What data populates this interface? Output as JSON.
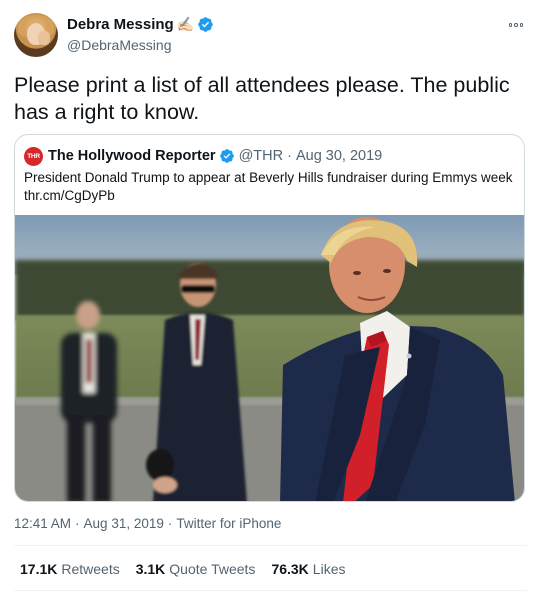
{
  "author": {
    "display_name": "Debra Messing",
    "name_emoji": "✍🏻",
    "handle": "@DebraMessing"
  },
  "tweet": {
    "text": "Please print a list of all attendees please. The public has a right to know."
  },
  "quoted_tweet": {
    "logo_text": "THR",
    "name": "The Hollywood Reporter",
    "handle": "@THR",
    "separator": "·",
    "date": "Aug 30, 2019",
    "text_line1": "President Donald Trump to appear at Beverly Hills fundraiser during Emmys week",
    "text_line2": "thr.cm/CgDyPb"
  },
  "meta": {
    "time": "12:41 AM",
    "date": "Aug 31, 2019",
    "separator": "·",
    "source": "Twitter for iPhone"
  },
  "stats": {
    "retweets_count": "17.1K",
    "retweets_label": "Retweets",
    "quotes_count": "3.1K",
    "quotes_label": "Quote Tweets",
    "likes_count": "76.3K",
    "likes_label": "Likes"
  },
  "icons": [
    "verified-icon",
    "more-icon"
  ],
  "colors": {
    "verified_blue": "#1d9bf0",
    "thr_red": "#d6282b",
    "secondary_text": "#536471"
  }
}
